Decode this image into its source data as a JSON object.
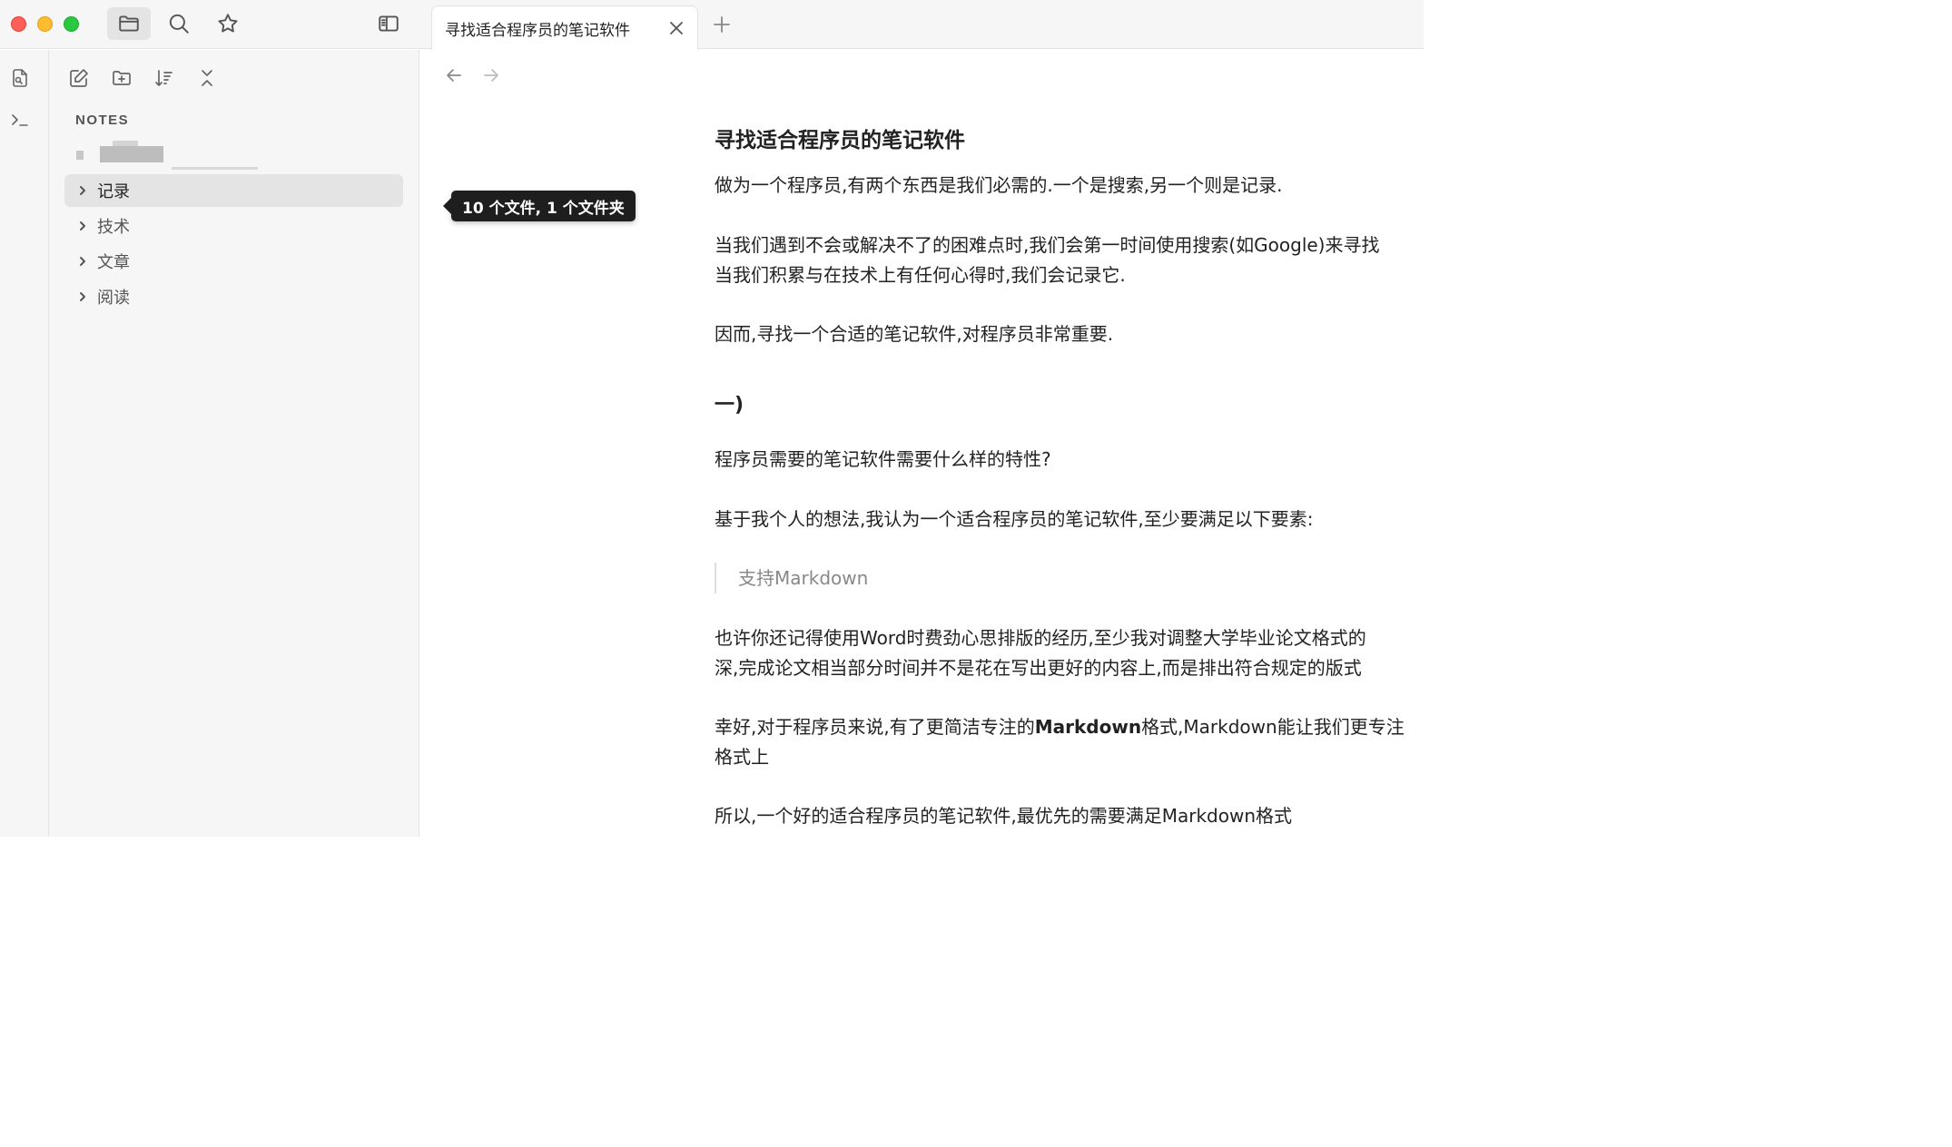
{
  "window": {
    "traffic_lights": [
      "close",
      "minimize",
      "zoom"
    ]
  },
  "top_icons": [
    "folder-icon",
    "search-icon",
    "star-icon",
    "sidebar-toggle-icon"
  ],
  "ribbon": [
    "file-search-icon",
    "terminal-icon"
  ],
  "sidebar": {
    "tools": [
      "new-note-icon",
      "new-folder-icon",
      "sort-icon",
      "collapse-all-icon"
    ],
    "vault_name": "NOTES",
    "folders": [
      {
        "label": "记录",
        "selected": true
      },
      {
        "label": "技术",
        "selected": false
      },
      {
        "label": "文章",
        "selected": false
      },
      {
        "label": "阅读",
        "selected": false
      }
    ]
  },
  "tooltip": "10 个文件, 1 个文件夹",
  "tabs": [
    {
      "title": "寻找适合程序员的笔记软件"
    }
  ],
  "document": {
    "title": "寻找适合程序员的笔记软件",
    "p1": "做为一个程序员,有两个东西是我们必需的.一个是搜索,另一个则是记录.",
    "p2_line1": "当我们遇到不会或解决不了的困难点时,我们会第一时间使用搜索(如Google)来寻找",
    "p2_line2": "当我们积累与在技术上有任何心得时,我们会记录它.",
    "p3": "因而,寻找一个合适的笔记软件,对程序员非常重要.",
    "h2": "一)",
    "p4": "程序员需要的笔记软件需要什么样的特性?",
    "p5": "基于我个人的想法,我认为一个适合程序员的笔记软件,至少要满足以下要素:",
    "quote": "支持Markdown",
    "p6_line1": "也许你还记得使用Word时费劲心思排版的经历,至少我对调整大学毕业论文格式的",
    "p6_line2": "深,完成论文相当部分时间并不是花在写出更好的内容上,而是排出符合规定的版式",
    "p7_part1": "幸好,对于程序员来说,有了更简洁专注的",
    "p7_bold": "Markdown",
    "p7_part2": "格式,Markdown能让我们更专注",
    "p7_line2": "格式上",
    "p8": "所以,一个好的适合程序员的笔记软件,最优先的需要满足Markdown格式"
  }
}
